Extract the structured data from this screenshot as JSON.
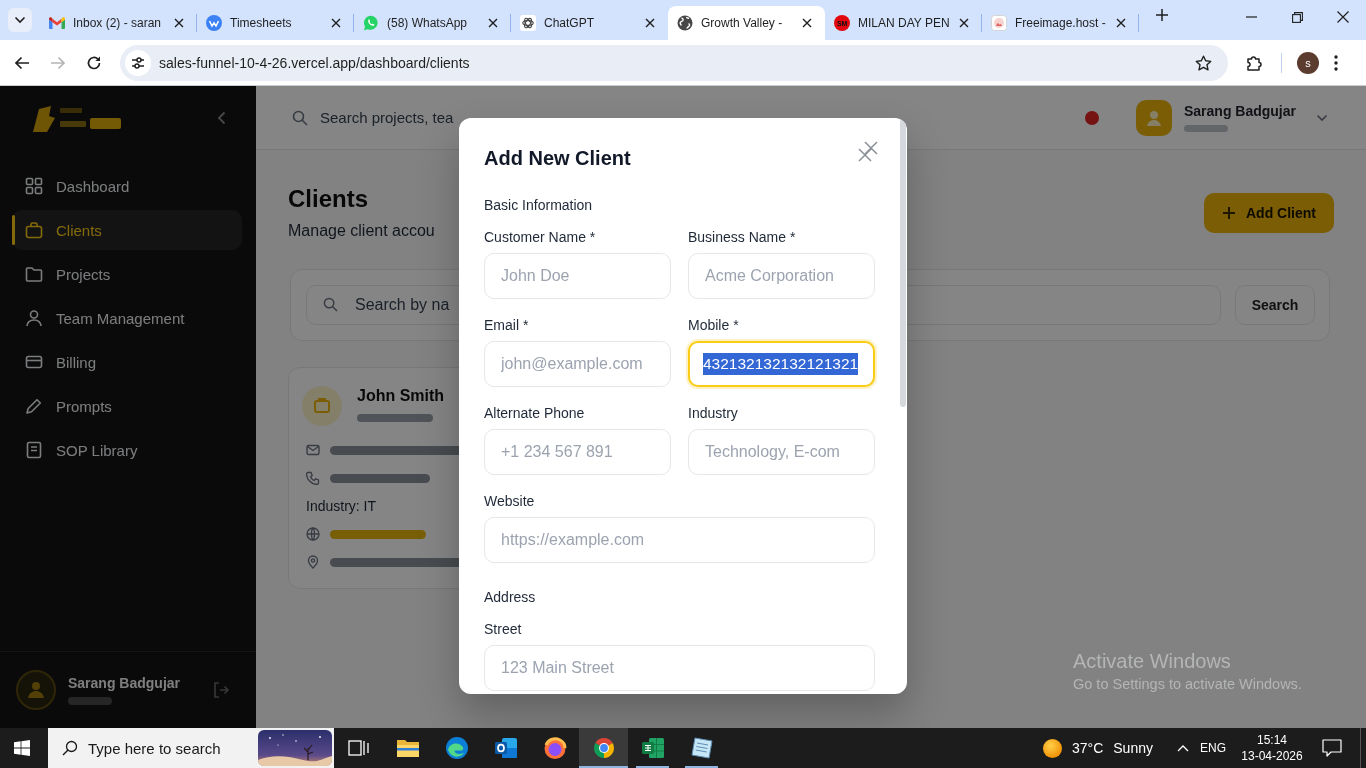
{
  "browser": {
    "tabs": [
      {
        "title": "Inbox (2) - saran",
        "selected": false
      },
      {
        "title": "Timesheets",
        "selected": false
      },
      {
        "title": "(58) WhatsApp",
        "selected": false
      },
      {
        "title": "ChatGPT",
        "selected": false
      },
      {
        "title": "Growth Valley -",
        "selected": true
      },
      {
        "title": "MILAN DAY PEN",
        "favicon_text": "SM",
        "selected": false
      },
      {
        "title": "Freeimage.host -",
        "selected": false
      }
    ],
    "nav_buttons": [
      {
        "disabled": false
      },
      {
        "disabled": true
      },
      {
        "disabled": false
      }
    ],
    "url": "sales-funnel-10-4-26.vercel.app/dashboard/clients",
    "profile_initial": "s"
  },
  "sidebar": {
    "items": [
      {
        "label": "Dashboard",
        "selected": false
      },
      {
        "label": "Clients",
        "selected": true
      },
      {
        "label": "Projects",
        "selected": false
      },
      {
        "label": "Team Management",
        "selected": false
      },
      {
        "label": "Billing",
        "selected": false
      },
      {
        "label": "Prompts",
        "selected": false
      },
      {
        "label": "SOP Library",
        "selected": false
      }
    ],
    "user": {
      "name": "Sarang Badgujar"
    }
  },
  "topbar": {
    "search_placeholder": "Search projects, tea",
    "user_name": "Sarang Badgujar"
  },
  "page": {
    "title": "Clients",
    "subtitle": "Manage client accou",
    "add_button": "Add Client",
    "search_placeholder": "Search by na",
    "search_button": "Search",
    "client": {
      "name": "John Smith",
      "industry": "Industry: IT"
    }
  },
  "modal": {
    "title": "Add New Client",
    "sections": [
      {
        "title": "Basic Information",
        "fields": [
          {
            "label": "Customer Name *",
            "placeholder": "John Doe",
            "wide": false,
            "focused": false,
            "text_selected": false
          },
          {
            "label": "Business Name *",
            "placeholder": "Acme Corporation",
            "wide": false,
            "focused": false,
            "text_selected": false
          },
          {
            "label": "Email *",
            "placeholder": "john@example.com",
            "wide": false,
            "focused": false,
            "text_selected": false
          },
          {
            "label": "Mobile *",
            "value": "432132132132121321",
            "wide": false,
            "focused": true,
            "text_selected": true
          },
          {
            "label": "Alternate Phone",
            "placeholder": "+1 234 567 891",
            "wide": false,
            "focused": false,
            "text_selected": false
          },
          {
            "label": "Industry",
            "placeholder": "Technology, E-com",
            "wide": false,
            "focused": false,
            "text_selected": false
          },
          {
            "label": "Website",
            "placeholder": "https://example.com",
            "wide": true,
            "focused": false,
            "text_selected": false
          }
        ]
      },
      {
        "title": "Address",
        "fields": [
          {
            "label": "Street",
            "placeholder": "123 Main Street",
            "wide": true,
            "focused": false,
            "text_selected": false
          }
        ]
      }
    ]
  },
  "os_watermark": {
    "title": "Activate Windows",
    "subtitle": "Go to Settings to activate Windows."
  },
  "taskbar": {
    "search_placeholder": "Type here to search",
    "apps": [
      {
        "running": false,
        "selected": false
      },
      {
        "running": false,
        "selected": false
      },
      {
        "running": false,
        "selected": false
      },
      {
        "running": false,
        "selected": false
      },
      {
        "running": false,
        "selected": false
      },
      {
        "running": true,
        "selected": true
      },
      {
        "running": true,
        "selected": false
      },
      {
        "running": true,
        "selected": false
      }
    ],
    "weather": {
      "temperature": "37°C",
      "condition": "Sunny"
    },
    "language": "ENG",
    "time": "15:14",
    "date": "13-04-2026"
  }
}
